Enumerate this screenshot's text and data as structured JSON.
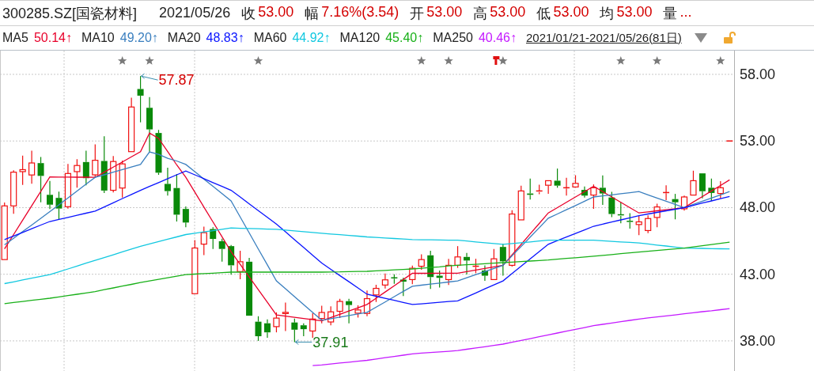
{
  "quote_bar": {
    "symbol": "300285.SZ[国瓷材料]",
    "date": "2021/05/26",
    "fields": [
      {
        "label": "收",
        "value": "53.00"
      },
      {
        "label": "幅",
        "value": "7.16%(3.54)"
      },
      {
        "label": "开",
        "value": "53.00"
      },
      {
        "label": "高",
        "value": "53.00"
      },
      {
        "label": "低",
        "value": "53.00"
      },
      {
        "label": "均",
        "value": "53.00"
      },
      {
        "label": "量",
        "value": "..."
      }
    ]
  },
  "indicator_bar": {
    "values": [
      "50.14↑",
      "49.20↑",
      "48.83↑",
      "44.92↑",
      "45.40↑",
      "40.46↑"
    ],
    "range": "2021/01/21-2021/05/26(81日)"
  },
  "chart": {
    "markers": [
      {
        "kind": "star"
      },
      {
        "kind": "star"
      },
      {
        "kind": "star"
      },
      {
        "kind": "star"
      },
      {
        "kind": "star"
      },
      {
        "kind": "flag"
      },
      {
        "kind": "star"
      },
      {
        "kind": "star"
      },
      {
        "kind": "star"
      },
      {
        "kind": "star"
      }
    ],
    "chart_data": {
      "type": "candlestick",
      "grid": true,
      "ylim": [
        35.74,
        59.78
      ],
      "yticks": [
        {
          "value": 58,
          "label": "58.00"
        },
        {
          "value": 53,
          "label": "53.00"
        },
        {
          "value": 48,
          "label": "48.00"
        },
        {
          "value": 43,
          "label": "43.00"
        },
        {
          "value": 38,
          "label": "38.00"
        }
      ],
      "ohlc": [
        [
          44.1,
          48.38,
          44.1,
          48.13
        ],
        [
          48.13,
          50.8,
          47.54,
          50.66
        ],
        [
          50.7,
          51.9,
          49.7,
          50.85
        ],
        [
          50.45,
          52.27,
          49.8,
          51.35
        ],
        [
          51.34,
          51.8,
          48.4,
          50.38
        ],
        [
          48.96,
          50.0,
          47.9,
          48.22
        ],
        [
          48.73,
          49.2,
          47.1,
          47.93
        ],
        [
          48.07,
          51.28,
          47.93,
          50.56
        ],
        [
          50.7,
          51.63,
          49.5,
          51.16
        ],
        [
          51.42,
          52.27,
          49.68,
          50.21
        ],
        [
          50.46,
          52.74,
          50.27,
          51.55
        ],
        [
          51.5,
          53.35,
          49.1,
          49.28
        ],
        [
          49.3,
          51.87,
          49.14,
          51.46
        ],
        [
          49.47,
          51.53,
          48.75,
          51.28
        ],
        [
          52.2,
          56.25,
          52.18,
          55.55
        ],
        [
          56.9,
          57.87,
          54.4,
          56.4
        ],
        [
          55.49,
          56.3,
          52.2,
          53.87
        ],
        [
          53.6,
          53.83,
          50.46,
          50.62
        ],
        [
          49.78,
          51.0,
          48.9,
          49.24
        ],
        [
          49.47,
          50.52,
          46.96,
          47.47
        ],
        [
          47.9,
          48.09,
          46.53,
          46.88
        ],
        [
          41.54,
          45.56,
          41.54,
          44.97
        ],
        [
          45.26,
          46.57,
          44.43,
          46.12
        ],
        [
          46.39,
          46.53,
          44.9,
          45.65
        ],
        [
          45.48,
          45.67,
          43.94,
          44.9
        ],
        [
          45.11,
          45.2,
          42.97,
          43.67
        ],
        [
          43.2,
          44.76,
          42.63,
          43.94
        ],
        [
          43.94,
          44.23,
          39.89,
          39.89
        ],
        [
          39.44,
          39.85,
          38.0,
          38.35
        ],
        [
          39.32,
          39.62,
          38.23,
          38.64
        ],
        [
          39.07,
          40.14,
          38.64,
          39.71
        ],
        [
          40.05,
          40.88,
          38.74,
          40.14
        ],
        [
          39.38,
          39.67,
          37.91,
          38.84
        ],
        [
          39.17,
          39.32,
          38.35,
          38.88
        ],
        [
          38.74,
          40.07,
          38.23,
          39.64
        ],
        [
          39.68,
          40.63,
          39.31,
          40.13
        ],
        [
          39.42,
          40.59,
          39.17,
          40.18
        ],
        [
          40.22,
          41.15,
          39.71,
          40.96
        ],
        [
          40.98,
          41.15,
          39.32,
          40.69
        ],
        [
          40.08,
          40.67,
          39.75,
          40.32
        ],
        [
          40.06,
          41.78,
          39.85,
          41.17
        ],
        [
          41.45,
          42.21,
          40.92,
          41.94
        ],
        [
          42.19,
          43.06,
          41.93,
          42.58
        ],
        [
          42.73,
          43.0,
          42.28,
          42.67
        ],
        [
          42.6,
          42.75,
          41.37,
          42.44
        ],
        [
          42.6,
          43.65,
          42.25,
          43.45
        ],
        [
          43.6,
          44.5,
          43.34,
          44.1
        ],
        [
          44.42,
          44.76,
          41.9,
          42.79
        ],
        [
          42.89,
          43.28,
          42.0,
          42.73
        ],
        [
          42.6,
          44.16,
          42.2,
          43.67
        ],
        [
          43.67,
          45.11,
          43.48,
          44.3
        ],
        [
          44.3,
          44.6,
          42.98,
          44.03
        ],
        [
          43.55,
          44.16,
          43.08,
          43.6
        ],
        [
          43.28,
          43.67,
          42.5,
          42.89
        ],
        [
          42.6,
          44.9,
          42.6,
          44.16
        ],
        [
          45.05,
          45.29,
          42.89,
          43.97
        ],
        [
          43.67,
          47.81,
          43.57,
          47.52
        ],
        [
          47.08,
          49.65,
          47.08,
          49.25
        ],
        [
          49.06,
          50.18,
          48.6,
          48.96
        ],
        [
          49.17,
          49.72,
          49.0,
          49.25
        ],
        [
          49.68,
          50.02,
          49.03,
          50.02
        ],
        [
          50.02,
          50.93,
          49.49,
          49.65
        ],
        [
          49.43,
          50.24,
          48.9,
          49.49
        ],
        [
          49.55,
          50.43,
          49.49,
          49.82
        ],
        [
          49.33,
          49.59,
          48.75,
          48.9
        ],
        [
          48.94,
          49.74,
          47.91,
          49.49
        ],
        [
          49.49,
          50.41,
          48.21,
          49.06
        ],
        [
          48.76,
          49.19,
          47.28,
          47.52
        ],
        [
          47.46,
          48.4,
          46.83,
          47.38
        ],
        [
          46.97,
          47.58,
          46.43,
          46.91
        ],
        [
          46.73,
          47.38,
          45.94,
          46.93
        ],
        [
          46.28,
          47.42,
          46.08,
          47.18
        ],
        [
          47.26,
          48.3,
          46.53,
          48.05
        ],
        [
          49.08,
          49.68,
          48.56,
          49.13
        ],
        [
          48.64,
          49.03,
          47.12,
          48.4
        ],
        [
          47.91,
          48.9,
          47.77,
          48.8
        ],
        [
          48.94,
          50.77,
          48.94,
          50.02
        ],
        [
          50.57,
          50.57,
          48.7,
          49.23
        ],
        [
          49.49,
          50.18,
          48.5,
          49.1
        ],
        [
          49.06,
          49.98,
          48.7,
          49.49
        ],
        [
          53.0,
          53.0,
          53.0,
          53.0
        ]
      ],
      "series": [
        {
          "name": "MA5",
          "type": "line",
          "color": "#e8002a",
          "values": [
            44.9,
            45.98,
            47.06,
            48.14,
            49.22,
            50.3,
            50.29,
            50.29,
            50.28,
            50.28,
            50.27,
            50.66,
            51.04,
            51.43,
            51.81,
            52.2,
            53.6,
            53.2,
            52.2,
            51.2,
            50.27,
            49.16,
            48.04,
            46.93,
            45.81,
            44.7,
            43.75,
            42.8,
            41.85,
            40.9,
            39.95,
            39.86,
            39.77,
            39.68,
            39.59,
            39.5,
            39.75,
            39.99,
            40.24,
            40.48,
            40.73,
            41.2,
            41.67,
            42.13,
            42.6,
            43.07,
            43.07,
            43.07,
            43.08,
            43.08,
            43.08,
            43.2,
            43.32,
            43.43,
            43.55,
            43.67,
            44.46,
            45.24,
            46.03,
            46.81,
            47.6,
            48.0,
            48.4,
            48.8,
            49.2,
            49.6,
            49.2,
            48.8,
            48.4,
            48.0,
            47.6,
            47.68,
            47.76,
            47.84,
            47.92,
            48.0,
            48.42,
            48.83,
            49.25,
            49.66,
            50.08
          ]
        },
        {
          "name": "MA10",
          "type": "line",
          "color": "#3a7fbf",
          "values": [
            45.2,
            45.7,
            46.2,
            46.7,
            47.2,
            47.7,
            48.21,
            48.73,
            49.24,
            49.76,
            50.27,
            50.46,
            50.66,
            50.85,
            51.05,
            51.24,
            52.18,
            52.0,
            51.7,
            51.5,
            51.24,
            50.69,
            50.14,
            49.6,
            49.05,
            48.5,
            47.3,
            46.1,
            44.9,
            43.7,
            42.5,
            41.91,
            41.32,
            40.73,
            40.14,
            39.55,
            39.67,
            39.79,
            39.9,
            40.02,
            40.14,
            40.53,
            40.92,
            41.32,
            41.71,
            42.1,
            42.18,
            42.26,
            42.34,
            42.42,
            42.5,
            42.73,
            42.97,
            43.2,
            43.44,
            43.67,
            44.38,
            45.08,
            45.79,
            46.49,
            47.2,
            47.52,
            47.84,
            48.16,
            48.48,
            48.8,
            48.88,
            48.96,
            49.04,
            49.12,
            49.2,
            48.96,
            48.72,
            48.48,
            48.24,
            48.0,
            48.24,
            48.48,
            48.72,
            48.96,
            49.2
          ]
        },
        {
          "name": "MA20",
          "type": "line",
          "color": "#0a14ff",
          "values": [
            45.6,
            45.87,
            46.14,
            46.42,
            46.69,
            46.96,
            47.12,
            47.27,
            47.43,
            47.58,
            47.74,
            48.05,
            48.36,
            48.68,
            48.99,
            49.3,
            49.59,
            49.88,
            50.17,
            50.46,
            50.75,
            50.46,
            50.17,
            49.88,
            49.59,
            49.3,
            48.79,
            48.28,
            47.78,
            47.27,
            46.76,
            46.18,
            45.59,
            45.01,
            44.42,
            43.84,
            43.37,
            42.9,
            42.44,
            41.97,
            41.5,
            41.35,
            41.19,
            41.04,
            40.88,
            40.73,
            40.78,
            40.84,
            40.89,
            40.95,
            41.0,
            41.3,
            41.6,
            41.9,
            42.2,
            42.5,
            43.05,
            43.6,
            44.15,
            44.7,
            45.25,
            45.52,
            45.79,
            46.06,
            46.33,
            46.6,
            46.76,
            46.92,
            47.08,
            47.24,
            47.4,
            47.52,
            47.64,
            47.76,
            47.88,
            48.0,
            48.17,
            48.34,
            48.5,
            48.67,
            48.84
          ]
        },
        {
          "name": "MA60",
          "type": "line",
          "color": "#12c8e0",
          "values": [
            42.3,
            42.43,
            42.57,
            42.7,
            42.84,
            42.97,
            43.18,
            43.4,
            43.61,
            43.83,
            44.04,
            44.25,
            44.46,
            44.68,
            44.89,
            45.1,
            45.28,
            45.45,
            45.63,
            45.8,
            45.98,
            46.08,
            46.18,
            46.27,
            46.37,
            46.47,
            46.45,
            46.43,
            46.41,
            46.39,
            46.37,
            46.31,
            46.26,
            46.2,
            46.14,
            46.08,
            46.02,
            45.97,
            45.91,
            45.86,
            45.8,
            45.76,
            45.72,
            45.68,
            45.64,
            45.6,
            45.59,
            45.58,
            45.57,
            45.56,
            45.55,
            45.49,
            45.43,
            45.37,
            45.31,
            45.25,
            45.31,
            45.37,
            45.43,
            45.49,
            45.55,
            45.55,
            45.55,
            45.55,
            45.55,
            45.55,
            45.51,
            45.47,
            45.43,
            45.39,
            45.35,
            45.27,
            45.19,
            45.12,
            45.04,
            44.96,
            44.95,
            44.94,
            44.92,
            44.91,
            44.9
          ]
        },
        {
          "name": "MA120",
          "type": "line",
          "color": "#18b018",
          "values": [
            40.8,
            40.88,
            40.96,
            41.04,
            41.12,
            41.2,
            41.3,
            41.4,
            41.5,
            41.6,
            41.7,
            41.84,
            41.97,
            42.11,
            42.24,
            42.38,
            42.5,
            42.62,
            42.73,
            42.85,
            42.97,
            43.01,
            43.05,
            43.08,
            43.12,
            43.16,
            43.16,
            43.16,
            43.16,
            43.16,
            43.16,
            43.16,
            43.16,
            43.16,
            43.16,
            43.16,
            43.17,
            43.18,
            43.2,
            43.21,
            43.22,
            43.26,
            43.29,
            43.33,
            43.36,
            43.4,
            43.45,
            43.51,
            43.56,
            43.62,
            43.67,
            43.71,
            43.75,
            43.79,
            43.83,
            43.87,
            43.91,
            43.95,
            43.99,
            44.03,
            44.07,
            44.13,
            44.19,
            44.24,
            44.3,
            44.36,
            44.42,
            44.48,
            44.54,
            44.6,
            44.66,
            44.72,
            44.78,
            44.84,
            44.9,
            44.96,
            45.05,
            45.14,
            45.23,
            45.32,
            45.41
          ]
        },
        {
          "name": "MA250",
          "type": "line",
          "color": "#c41aff",
          "values": [
            null,
            null,
            null,
            null,
            null,
            null,
            null,
            null,
            null,
            null,
            null,
            null,
            null,
            null,
            null,
            null,
            null,
            null,
            null,
            null,
            null,
            null,
            null,
            null,
            null,
            null,
            null,
            null,
            null,
            null,
            null,
            null,
            null,
            null,
            36.15,
            36.2,
            36.27,
            36.34,
            36.4,
            36.47,
            36.54,
            36.64,
            36.74,
            36.83,
            36.93,
            37.03,
            37.08,
            37.13,
            37.17,
            37.22,
            37.27,
            37.37,
            37.47,
            37.56,
            37.66,
            37.76,
            37.9,
            38.04,
            38.17,
            38.31,
            38.45,
            38.59,
            38.73,
            38.86,
            39.0,
            39.14,
            39.24,
            39.34,
            39.44,
            39.54,
            39.64,
            39.72,
            39.8,
            39.87,
            39.95,
            40.03,
            40.11,
            40.19,
            40.26,
            40.34,
            40.42
          ]
        }
      ],
      "annotations": [
        "57.87",
        "37.91"
      ]
    }
  }
}
